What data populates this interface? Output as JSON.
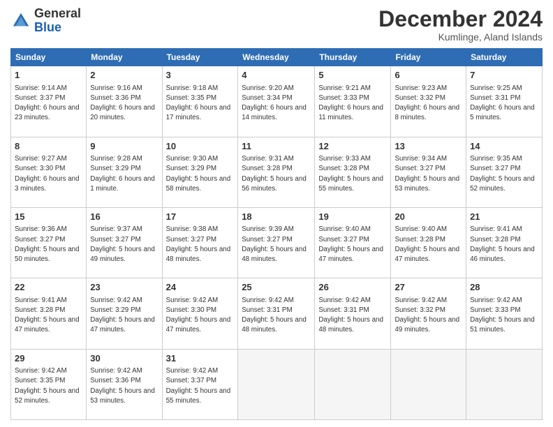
{
  "header": {
    "logo_general": "General",
    "logo_blue": "Blue",
    "month_title": "December 2024",
    "subtitle": "Kumlinge, Aland Islands"
  },
  "weekdays": [
    "Sunday",
    "Monday",
    "Tuesday",
    "Wednesday",
    "Thursday",
    "Friday",
    "Saturday"
  ],
  "weeks": [
    [
      {
        "day": "1",
        "sunrise": "9:14 AM",
        "sunset": "3:37 PM",
        "daylight": "6 hours and 23 minutes."
      },
      {
        "day": "2",
        "sunrise": "9:16 AM",
        "sunset": "3:36 PM",
        "daylight": "6 hours and 20 minutes."
      },
      {
        "day": "3",
        "sunrise": "9:18 AM",
        "sunset": "3:35 PM",
        "daylight": "6 hours and 17 minutes."
      },
      {
        "day": "4",
        "sunrise": "9:20 AM",
        "sunset": "3:34 PM",
        "daylight": "6 hours and 14 minutes."
      },
      {
        "day": "5",
        "sunrise": "9:21 AM",
        "sunset": "3:33 PM",
        "daylight": "6 hours and 11 minutes."
      },
      {
        "day": "6",
        "sunrise": "9:23 AM",
        "sunset": "3:32 PM",
        "daylight": "6 hours and 8 minutes."
      },
      {
        "day": "7",
        "sunrise": "9:25 AM",
        "sunset": "3:31 PM",
        "daylight": "6 hours and 5 minutes."
      }
    ],
    [
      {
        "day": "8",
        "sunrise": "9:27 AM",
        "sunset": "3:30 PM",
        "daylight": "6 hours and 3 minutes."
      },
      {
        "day": "9",
        "sunrise": "9:28 AM",
        "sunset": "3:29 PM",
        "daylight": "6 hours and 1 minute."
      },
      {
        "day": "10",
        "sunrise": "9:30 AM",
        "sunset": "3:29 PM",
        "daylight": "5 hours and 58 minutes."
      },
      {
        "day": "11",
        "sunrise": "9:31 AM",
        "sunset": "3:28 PM",
        "daylight": "5 hours and 56 minutes."
      },
      {
        "day": "12",
        "sunrise": "9:33 AM",
        "sunset": "3:28 PM",
        "daylight": "5 hours and 55 minutes."
      },
      {
        "day": "13",
        "sunrise": "9:34 AM",
        "sunset": "3:27 PM",
        "daylight": "5 hours and 53 minutes."
      },
      {
        "day": "14",
        "sunrise": "9:35 AM",
        "sunset": "3:27 PM",
        "daylight": "5 hours and 52 minutes."
      }
    ],
    [
      {
        "day": "15",
        "sunrise": "9:36 AM",
        "sunset": "3:27 PM",
        "daylight": "5 hours and 50 minutes."
      },
      {
        "day": "16",
        "sunrise": "9:37 AM",
        "sunset": "3:27 PM",
        "daylight": "5 hours and 49 minutes."
      },
      {
        "day": "17",
        "sunrise": "9:38 AM",
        "sunset": "3:27 PM",
        "daylight": "5 hours and 48 minutes."
      },
      {
        "day": "18",
        "sunrise": "9:39 AM",
        "sunset": "3:27 PM",
        "daylight": "5 hours and 48 minutes."
      },
      {
        "day": "19",
        "sunrise": "9:40 AM",
        "sunset": "3:27 PM",
        "daylight": "5 hours and 47 minutes."
      },
      {
        "day": "20",
        "sunrise": "9:40 AM",
        "sunset": "3:28 PM",
        "daylight": "5 hours and 47 minutes."
      },
      {
        "day": "21",
        "sunrise": "9:41 AM",
        "sunset": "3:28 PM",
        "daylight": "5 hours and 46 minutes."
      }
    ],
    [
      {
        "day": "22",
        "sunrise": "9:41 AM",
        "sunset": "3:28 PM",
        "daylight": "5 hours and 47 minutes."
      },
      {
        "day": "23",
        "sunrise": "9:42 AM",
        "sunset": "3:29 PM",
        "daylight": "5 hours and 47 minutes."
      },
      {
        "day": "24",
        "sunrise": "9:42 AM",
        "sunset": "3:30 PM",
        "daylight": "5 hours and 47 minutes."
      },
      {
        "day": "25",
        "sunrise": "9:42 AM",
        "sunset": "3:31 PM",
        "daylight": "5 hours and 48 minutes."
      },
      {
        "day": "26",
        "sunrise": "9:42 AM",
        "sunset": "3:31 PM",
        "daylight": "5 hours and 48 minutes."
      },
      {
        "day": "27",
        "sunrise": "9:42 AM",
        "sunset": "3:32 PM",
        "daylight": "5 hours and 49 minutes."
      },
      {
        "day": "28",
        "sunrise": "9:42 AM",
        "sunset": "3:33 PM",
        "daylight": "5 hours and 51 minutes."
      }
    ],
    [
      {
        "day": "29",
        "sunrise": "9:42 AM",
        "sunset": "3:35 PM",
        "daylight": "5 hours and 52 minutes."
      },
      {
        "day": "30",
        "sunrise": "9:42 AM",
        "sunset": "3:36 PM",
        "daylight": "5 hours and 53 minutes."
      },
      {
        "day": "31",
        "sunrise": "9:42 AM",
        "sunset": "3:37 PM",
        "daylight": "5 hours and 55 minutes."
      },
      null,
      null,
      null,
      null
    ]
  ]
}
